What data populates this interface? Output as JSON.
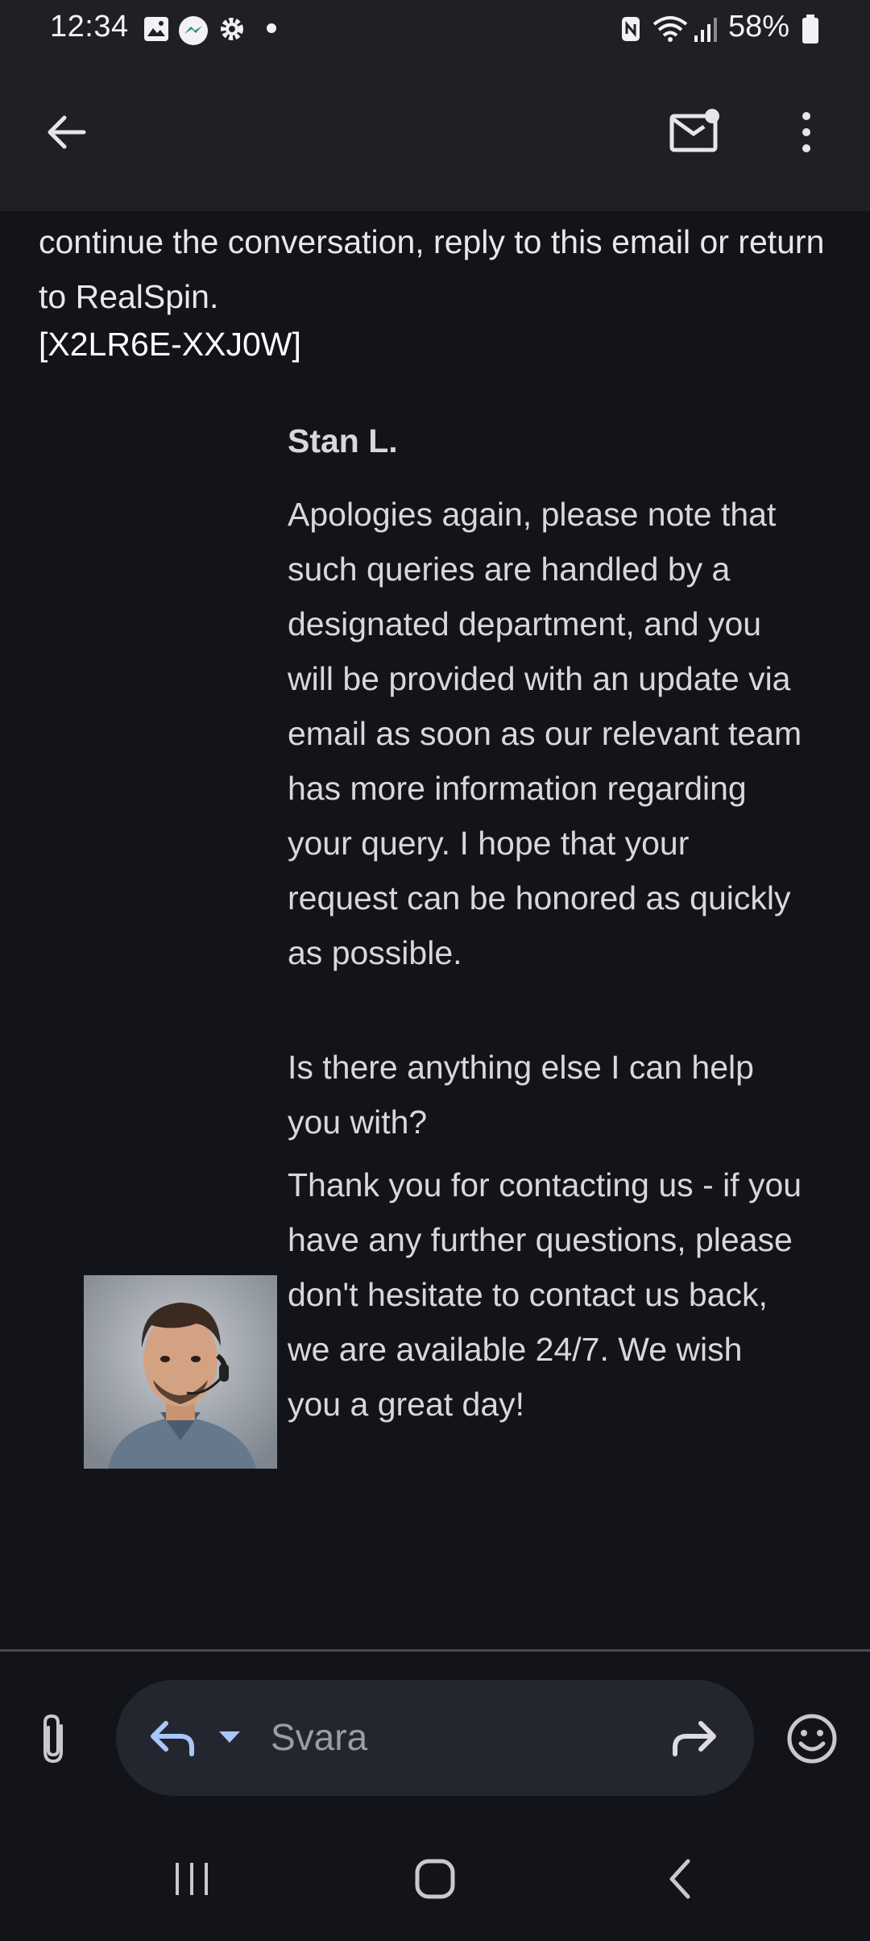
{
  "status_bar": {
    "time": "12:34",
    "battery": "58%",
    "icons": [
      "image-icon",
      "messenger-icon",
      "settings-icon",
      "dot-icon",
      "nfc-icon",
      "wifi-icon",
      "signal-icon",
      "battery-icon"
    ]
  },
  "app_bar": {
    "icons": [
      "back-arrow-icon",
      "mark-unread-icon",
      "more-options-icon"
    ]
  },
  "email": {
    "intro_text": "continue the conversation, reply to this email or return to RealSpin.",
    "ref_code": "[X2LR6E-XXJ0W]",
    "sender": "Stan L.",
    "messages": [
      "Apologies again, please note that such queries are handled by a designated department, and you will be provided with an update via email as soon as our relevant team has more information regarding your query. I hope that your request can be honored as quickly as possible.",
      "Is there anything else I can help you with?",
      "Thank you for contacting us - if you have any further questions, please don't hesitate to contact us back, we are available 24/7. We wish you a great day!"
    ]
  },
  "reply_bar": {
    "placeholder": "Svara",
    "icons": [
      "attach-icon",
      "reply-icon",
      "dropdown-icon",
      "forward-icon",
      "emoji-icon"
    ]
  },
  "nav_bar": {
    "icons": [
      "recents-icon",
      "home-icon",
      "back-icon"
    ]
  },
  "colors": {
    "background": "#131419",
    "app_bar": "#1f1f24",
    "accent": "#a8c7fa",
    "text": "#e6e6ea"
  }
}
